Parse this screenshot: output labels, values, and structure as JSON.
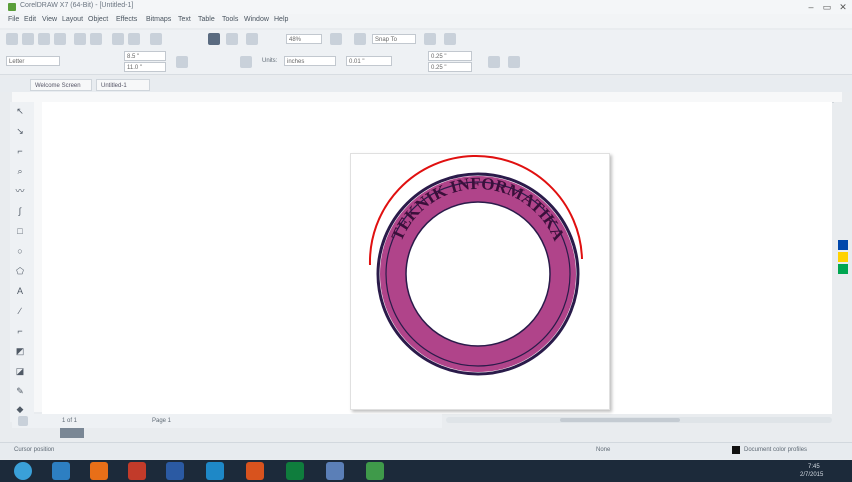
{
  "window": {
    "title": "CorelDRAW X7 (64-Bit) - [Untitled-1]",
    "controls": [
      "‒",
      "▭",
      "✕"
    ]
  },
  "menu": [
    "File",
    "Edit",
    "View",
    "Layout",
    "Object",
    "Effects",
    "Bitmaps",
    "Text",
    "Table",
    "Tools",
    "Window",
    "Help"
  ],
  "toolbar": {
    "zoom": "48%",
    "snap_label": "Snap To",
    "page_size": "Letter",
    "width": "8.5 \"",
    "height": "11.0 \"",
    "units_label": "Units:",
    "units": "inches",
    "nudge": "0.01 \"",
    "duplicate_x": "0.25 \"",
    "duplicate_y": "0.25 \""
  },
  "tabs": [
    "Welcome Screen",
    "Untitled-1"
  ],
  "page_nav": {
    "position": "1 of 1",
    "page_tab": "Page 1"
  },
  "status": {
    "cursor": "Cursor position",
    "fill_label": "None",
    "color_profile": "Document color profiles"
  },
  "taskbar": {
    "time": "7:45",
    "date": "2/7/2015"
  },
  "artwork": {
    "ring_text": "TEKNIK INFORMATIKA",
    "ring_fill": "#b0448a",
    "ring_outline": "#2a1b4a",
    "text_color": "#3a0f3a",
    "arc_color": "#e01010"
  }
}
